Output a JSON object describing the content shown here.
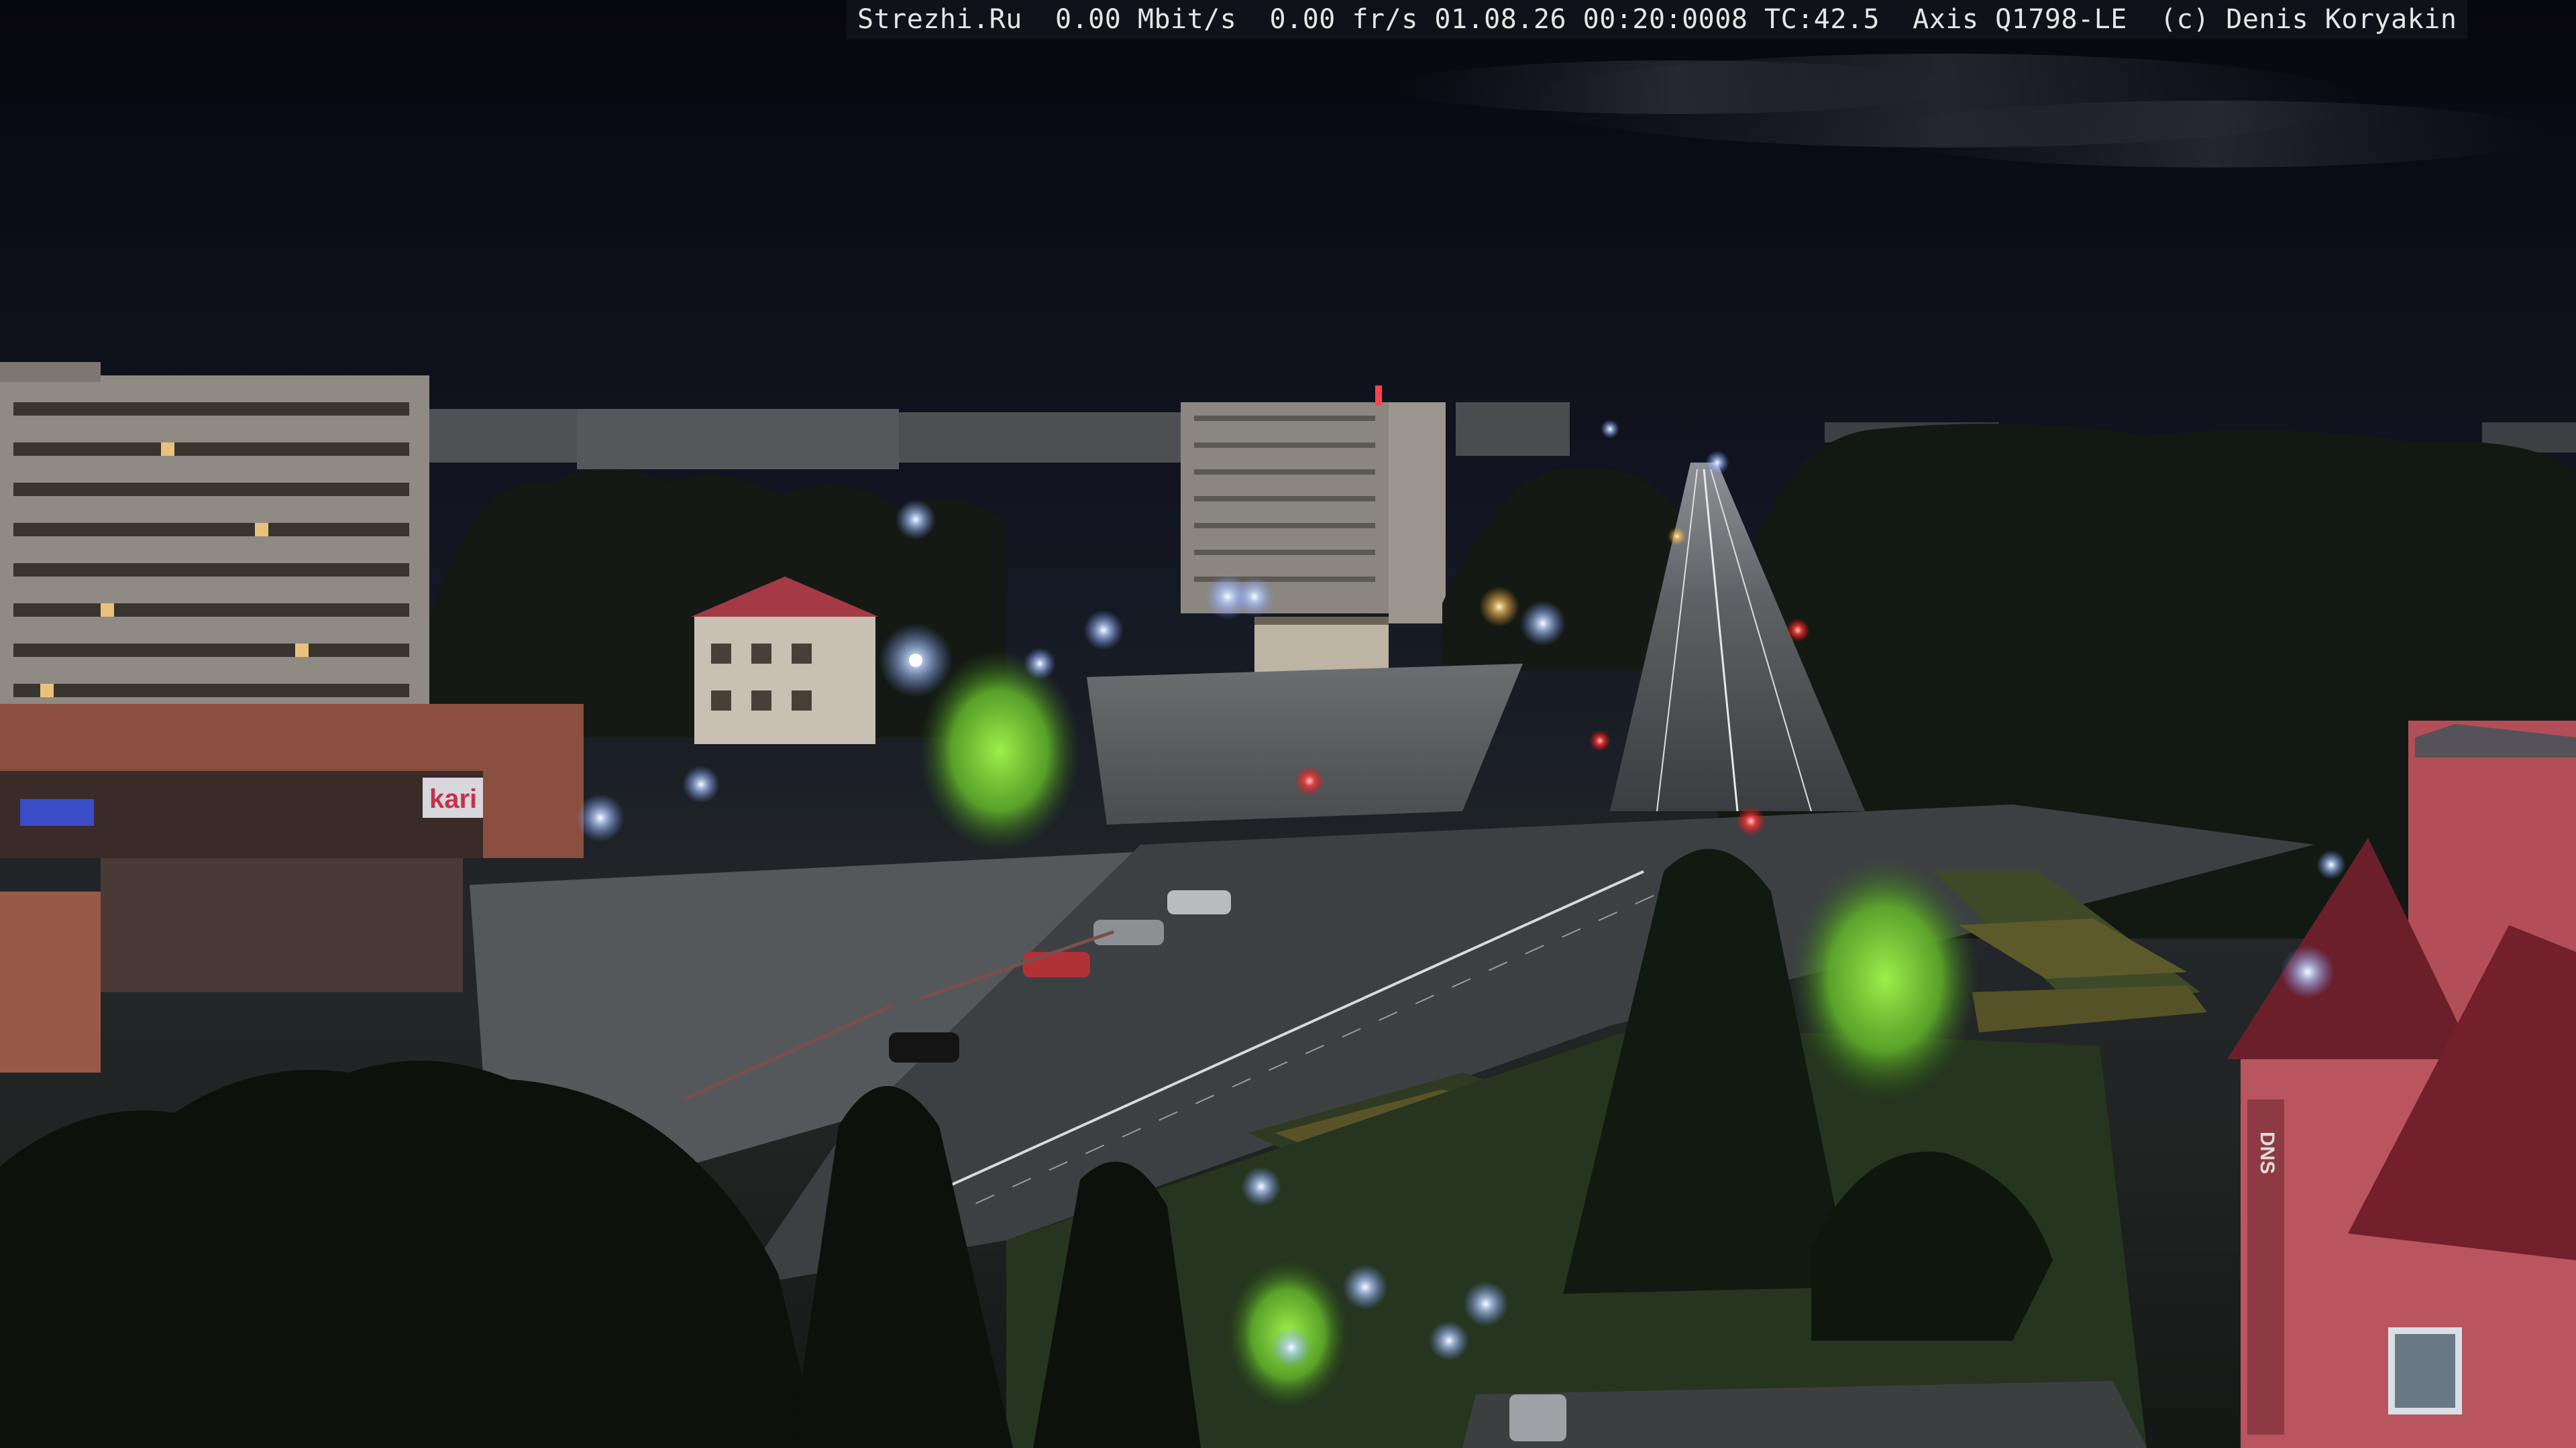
{
  "overlay": {
    "text": "Strezhi.Ru  0.00 Mbit/s  0.00 fr/s 01.08.26 00:20:0008 TC:42.5  Axis Q1798-LE  (c) Denis Koryakin"
  },
  "scene": {
    "description_tags": [
      "night-city-webcam",
      "street-intersection",
      "apartment-blocks",
      "street-lights",
      "trees"
    ]
  },
  "signs": {
    "store_left": "kari",
    "store_right": "DNS"
  },
  "colors": {
    "sky_top": "#07080d",
    "sky_horizon": "#1a1f25",
    "street_light": "#cfe0ff",
    "street_light_warm": "#ffd27a",
    "tree_dark": "#10160f",
    "tree_lit": "#7fd23a",
    "asphalt": "#3d4043",
    "building_pink": "#c25a62"
  }
}
